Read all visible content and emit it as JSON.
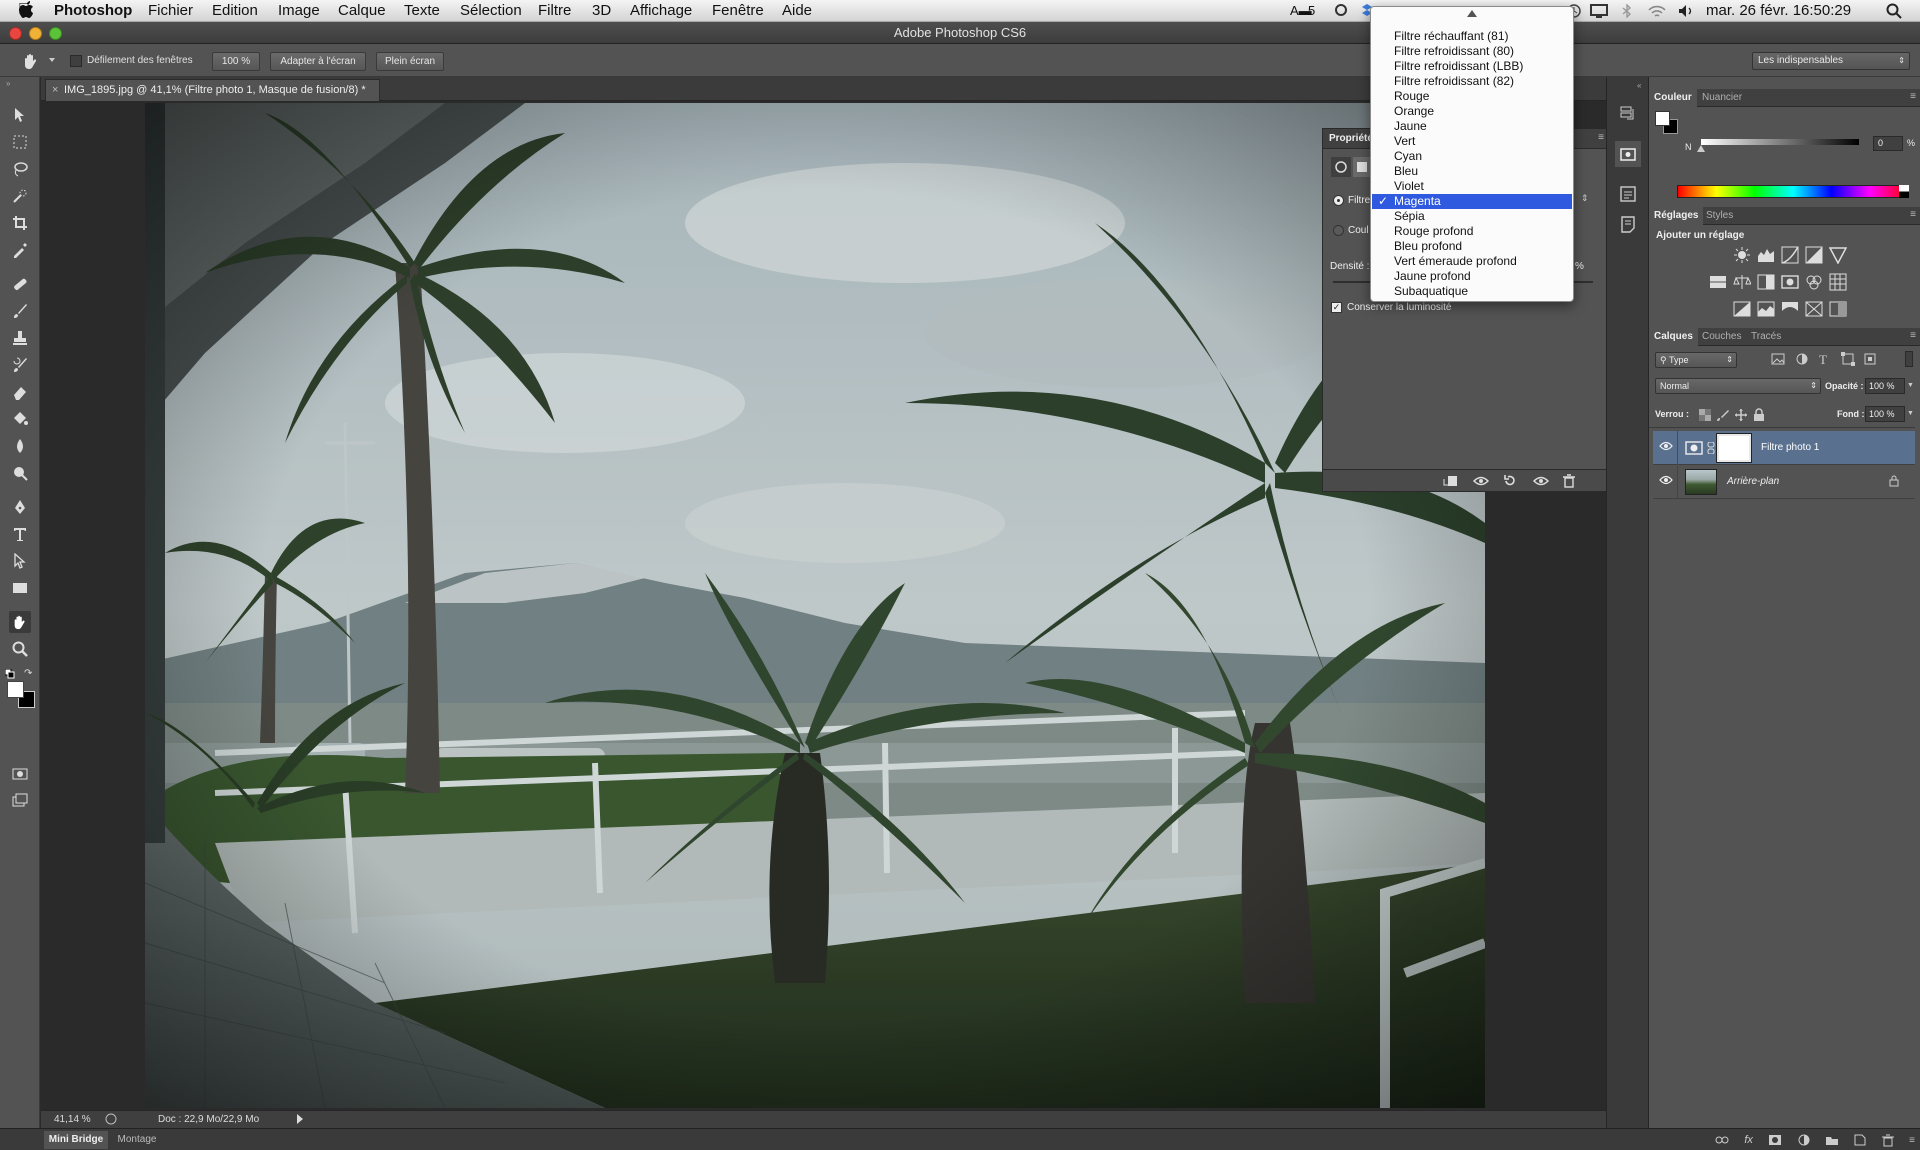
{
  "menubar": {
    "app": "Photoshop",
    "items": [
      "Fichier",
      "Edition",
      "Image",
      "Calque",
      "Texte",
      "Sélection",
      "Filtre",
      "3D",
      "Affichage",
      "Fenêtre",
      "Aide"
    ],
    "status_badge": "5",
    "clock": "mar. 26 févr.  16:50:29"
  },
  "window": {
    "title": "Adobe Photoshop CS6"
  },
  "options_bar": {
    "scroll_all_label": "Défilement des fenêtres",
    "zoom_100": "100 %",
    "fit_screen": "Adapter à l'écran",
    "full_screen": "Plein écran",
    "workspace": "Les indispensables"
  },
  "document": {
    "tab_title": "IMG_1895.jpg @ 41,1% (Filtre photo 1, Masque de fusion/8) *",
    "zoom": "41,14 %",
    "doc_info": "Doc : 22,9 Mo/22,9 Mo"
  },
  "properties": {
    "title": "Propriétés",
    "filter_label": "Filtre",
    "color_label": "Coul",
    "density_label": "Densité :",
    "preserve_luminosity": "Conserver la luminosité"
  },
  "dropdown": {
    "options": [
      "Filtre réchauffant (81)",
      "Filtre refroidissant (80)",
      "Filtre refroidissant (LBB)",
      "Filtre refroidissant (82)",
      "Rouge",
      "Orange",
      "Jaune",
      "Vert",
      "Cyan",
      "Bleu",
      "Violet",
      "Magenta",
      "Sépia",
      "Rouge profond",
      "Bleu profond",
      "Vert émeraude profond",
      "Jaune profond",
      "Subaquatique"
    ],
    "selected": "Magenta"
  },
  "color_panel": {
    "tabs": [
      "Couleur",
      "Nuancier"
    ],
    "slider_label": "N",
    "value": "0",
    "unit": "%"
  },
  "adjustments_panel": {
    "tabs": [
      "Réglages",
      "Styles"
    ],
    "heading": "Ajouter un réglage"
  },
  "layers_panel": {
    "tabs": [
      "Calques",
      "Couches",
      "Tracés"
    ],
    "filter_type": "Type",
    "blend_mode": "Normal",
    "opacity_label": "Opacité :",
    "opacity_value": "100 %",
    "lock_label": "Verrou :",
    "fill_label": "Fond :",
    "fill_value": "100 %",
    "layers": [
      {
        "name": "Filtre photo 1"
      },
      {
        "name": "Arrière-plan"
      }
    ]
  },
  "bottom_tabs": [
    "Mini Bridge",
    "Montage"
  ],
  "colors": {
    "selection": "#2f5ae0",
    "panel": "#535353",
    "layer_selected": "#59718f"
  }
}
